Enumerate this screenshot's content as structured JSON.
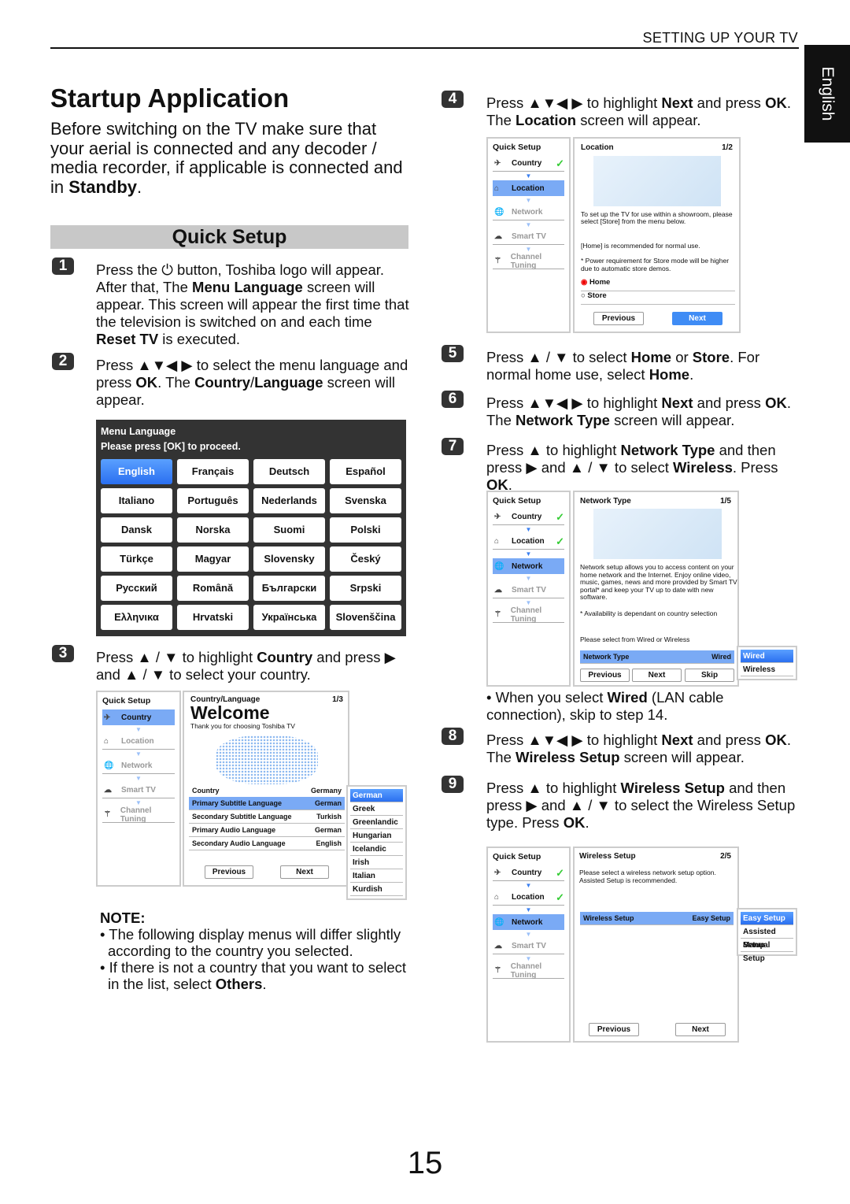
{
  "header": "SETTING UP YOUR TV",
  "side_tab": "English",
  "title": "Startup Application",
  "intro": [
    {
      "t": "Before switching on the TV make sure that your aerial is connected and any decoder / media recorder, if applicable is connected and in "
    },
    {
      "t": "Standby",
      "b": 1
    },
    {
      "t": "."
    }
  ],
  "section": "Quick Setup",
  "steps": [
    {
      "n": "1",
      "text": [
        {
          "t": "Press the ⏻ button, Toshiba logo will appear. After that, The "
        },
        {
          "t": "Menu Language",
          "b": 1
        },
        {
          "t": " screen will appear. This screen will appear the first time that the television is switched on and each time "
        },
        {
          "t": "Reset TV",
          "b": 1
        },
        {
          "t": " is executed."
        }
      ]
    },
    {
      "n": "2",
      "text": [
        {
          "t": "Press ▲▼◀ ▶ to select the menu language and press "
        },
        {
          "t": "OK",
          "b": 1
        },
        {
          "t": ". The "
        },
        {
          "t": "Country",
          "b": 1
        },
        {
          "t": "/"
        },
        {
          "t": "Language",
          "b": 1
        },
        {
          "t": " screen will appear."
        }
      ]
    },
    {
      "n": "3",
      "text": [
        {
          "t": "Press ▲ / ▼ to highlight "
        },
        {
          "t": "Country",
          "b": 1
        },
        {
          "t": " and press ▶ and ▲ / ▼ to select your country."
        }
      ]
    },
    {
      "n": "4",
      "text": [
        {
          "t": "Press ▲▼◀ ▶ to highlight "
        },
        {
          "t": "Next",
          "b": 1
        },
        {
          "t": " and press "
        },
        {
          "t": "OK",
          "b": 1
        },
        {
          "t": ". The "
        },
        {
          "t": "Location",
          "b": 1
        },
        {
          "t": " screen will appear."
        }
      ]
    },
    {
      "n": "5",
      "text": [
        {
          "t": "Press ▲ / ▼ to select "
        },
        {
          "t": "Home",
          "b": 1
        },
        {
          "t": " or "
        },
        {
          "t": "Store",
          "b": 1
        },
        {
          "t": ". For normal home use, select "
        },
        {
          "t": "Home",
          "b": 1
        },
        {
          "t": "."
        }
      ]
    },
    {
      "n": "6",
      "text": [
        {
          "t": "Press ▲▼◀ ▶ to highlight "
        },
        {
          "t": "Next",
          "b": 1
        },
        {
          "t": " and press "
        },
        {
          "t": "OK",
          "b": 1
        },
        {
          "t": ". The "
        },
        {
          "t": "Network Type",
          "b": 1
        },
        {
          "t": " screen will appear."
        }
      ]
    },
    {
      "n": "7",
      "text": [
        {
          "t": "Press ▲ to highlight "
        },
        {
          "t": "Network Type",
          "b": 1
        },
        {
          "t": " and then press ▶ and ▲ / ▼ to select "
        },
        {
          "t": "Wireless",
          "b": 1
        },
        {
          "t": ". Press "
        },
        {
          "t": "OK",
          "b": 1
        },
        {
          "t": "."
        }
      ]
    },
    {
      "n": "8",
      "text": [
        {
          "t": "Press ▲▼◀ ▶ to highlight "
        },
        {
          "t": "Next",
          "b": 1
        },
        {
          "t": " and press "
        },
        {
          "t": "OK",
          "b": 1
        },
        {
          "t": ". The "
        },
        {
          "t": "Wireless Setup",
          "b": 1
        },
        {
          "t": " screen will appear."
        }
      ]
    },
    {
      "n": "9",
      "text": [
        {
          "t": "Press ▲ to highlight "
        },
        {
          "t": "Wireless Setup",
          "b": 1
        },
        {
          "t": " and then press ▶ and ▲ / ▼ to select the Wireless Setup type. Press "
        },
        {
          "t": "OK",
          "b": 1
        },
        {
          "t": "."
        }
      ]
    }
  ],
  "wired_bullet": [
    {
      "t": "• When you select "
    },
    {
      "t": "Wired",
      "b": 1
    },
    {
      "t": " (LAN cable connection), skip to step 14."
    }
  ],
  "menu_language": {
    "title": "Menu Language",
    "prompt": "Please press [OK] to proceed.",
    "selected": "English",
    "languages": [
      "English",
      "Français",
      "Deutsch",
      "Español",
      "Italiano",
      "Português",
      "Nederlands",
      "Svenska",
      "Dansk",
      "Norska",
      "Suomi",
      "Polski",
      "Türkçe",
      "Magyar",
      "Slovensky",
      "Český",
      "Русский",
      "Română",
      "Български",
      "Srpski",
      "Ελληνικα",
      "Hrvatski",
      "Українська",
      "Slovenščina"
    ]
  },
  "sidebar": {
    "title": "Quick Setup",
    "items": [
      {
        "label": "Country",
        "icon": "country-icon",
        "glyph": "✈"
      },
      {
        "label": "Location",
        "icon": "home-icon",
        "glyph": "⌂"
      },
      {
        "label": "Network",
        "icon": "globe-icon",
        "glyph": "🌐"
      },
      {
        "label": "Smart TV",
        "icon": "smart-tv-icon",
        "glyph": "☁"
      },
      {
        "label": "Channel Tuning",
        "icon": "antenna-icon",
        "glyph": "⚚"
      }
    ]
  },
  "country_screen": {
    "title": "Country/Language",
    "page": "1/3",
    "heading": "Welcome",
    "sub": "Thank you for choosing Toshiba TV",
    "rows": [
      {
        "label": "Country",
        "value": "Germany"
      },
      {
        "label": "Primary Subtitle Language",
        "value": "German"
      },
      {
        "label": "Secondary Subtitle Language",
        "value": "Turkish"
      },
      {
        "label": "Primary Audio Language",
        "value": "German"
      },
      {
        "label": "Secondary Audio Language",
        "value": "English"
      }
    ],
    "dropdown": [
      "German",
      "Greek",
      "Greenlandic",
      "Hungarian",
      "Icelandic",
      "Irish",
      "Italian",
      "Kurdish"
    ],
    "prev": "Previous",
    "next": "Next"
  },
  "location_screen": {
    "title": "Location",
    "page": "1/2",
    "text1": "To set up the TV for use within a showroom, please select [Store] from the menu below.",
    "text2": "[Home] is recommended for normal use.",
    "text3": "* Power requirement for Store mode will be higher due to automatic store demos.",
    "options": [
      "Home",
      "Store"
    ],
    "selected": "Home",
    "prev": "Previous",
    "next": "Next"
  },
  "network_screen": {
    "title": "Network Type",
    "page": "1/5",
    "text1": "Network setup allows you to access content on your home network and the Internet. Enjoy online video, music, games, news and more provided by Smart TV portal* and keep your TV up to date with new software.",
    "text2": "* Availability is dependant on country selection",
    "text3": "Please select from Wired or Wireless",
    "row_label": "Network Type",
    "row_value": "Wired",
    "dropdown": [
      "Wired",
      "Wireless"
    ],
    "prev": "Previous",
    "next": "Next",
    "skip": "Skip"
  },
  "wireless_screen": {
    "title": "Wireless Setup",
    "page": "2/5",
    "text1": "Please select a wireless network setup option. Assisted Setup is recommended.",
    "row_label": "Wireless Setup",
    "row_value": "Easy Setup",
    "dropdown": [
      "Easy Setup",
      "Assisted Setup",
      "Manual Setup"
    ],
    "prev": "Previous",
    "next": "Next"
  },
  "note": {
    "title": "NOTE:",
    "items": [
      [
        {
          "t": "The following display menus will differ slightly according to the country you selected."
        }
      ],
      [
        {
          "t": "If there is not a country that you want to select in the list, select "
        },
        {
          "t": "Others",
          "b": 1
        },
        {
          "t": "."
        }
      ]
    ]
  },
  "page_number": "15",
  "colors": {
    "highlight": "#7aaaf5",
    "button_blue": "#3f8cf5",
    "badge": "#333333"
  }
}
